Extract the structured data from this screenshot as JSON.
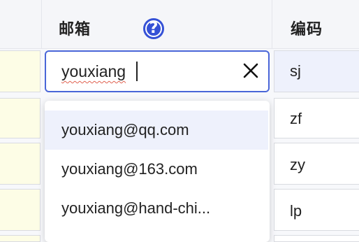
{
  "header": {
    "email_label": "邮箱",
    "code_label": "编码",
    "help_icon": "question-circle-icon"
  },
  "email_input": {
    "value": "youxiang",
    "clear_icon": "close-icon"
  },
  "suggestions": [
    "youxiang@qq.com",
    "youxiang@163.com",
    "youxiang@hand-chi..."
  ],
  "codes": [
    "sj",
    "zf",
    "zy",
    "lp"
  ],
  "colors": {
    "accent": "#3551d6",
    "input_border": "#4a66d8",
    "highlight": "#eef1fc",
    "yellow_cell": "#fdfde6"
  }
}
